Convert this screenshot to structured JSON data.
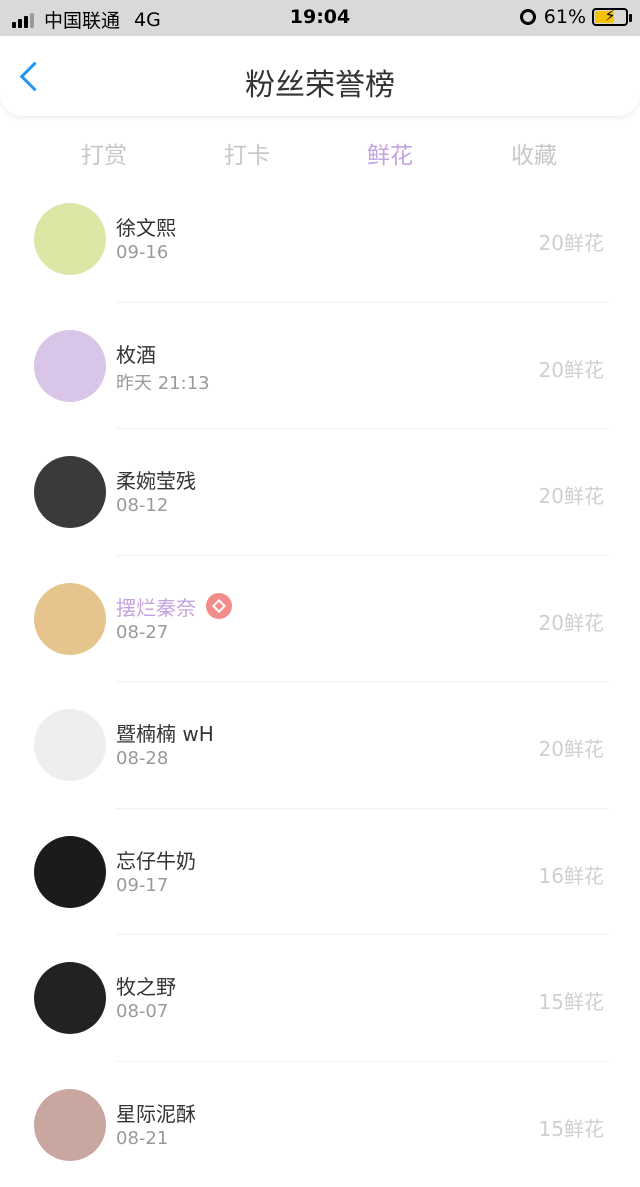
{
  "status": {
    "carrier": "中国联通",
    "network": "4G",
    "time": "19:04",
    "battery": "61%"
  },
  "header": {
    "title": "粉丝荣誉榜"
  },
  "tabs": [
    {
      "label": "打赏"
    },
    {
      "label": "打卡"
    },
    {
      "label": "鲜花"
    },
    {
      "label": "收藏"
    }
  ],
  "list": [
    {
      "name": "徐文熙",
      "date": "09-16",
      "amount": "20鲜花",
      "avatar_color": "#dbe7a5"
    },
    {
      "name": "枚酒",
      "date": "昨天 21:13",
      "amount": "20鲜花",
      "avatar_color": "#d9c5e8"
    },
    {
      "name": "柔婉莹残",
      "date": "08-12",
      "amount": "20鲜花",
      "avatar_color": "#3a3a3a"
    },
    {
      "name": "摆烂秦奈",
      "date": "08-27",
      "amount": "20鲜花",
      "avatar_color": "#e5c48e"
    },
    {
      "name": "暨楠楠 wH",
      "date": "08-28",
      "amount": "20鲜花",
      "avatar_color": "#eeeeee"
    },
    {
      "name": "忘仔牛奶",
      "date": "09-17",
      "amount": "16鲜花",
      "avatar_color": "#1b1b1b"
    },
    {
      "name": "牧之野",
      "date": "08-07",
      "amount": "15鲜花",
      "avatar_color": "#222222"
    },
    {
      "name": "星际泥酥",
      "date": "08-21",
      "amount": "15鲜花",
      "avatar_color": "#c9a6a0"
    }
  ]
}
